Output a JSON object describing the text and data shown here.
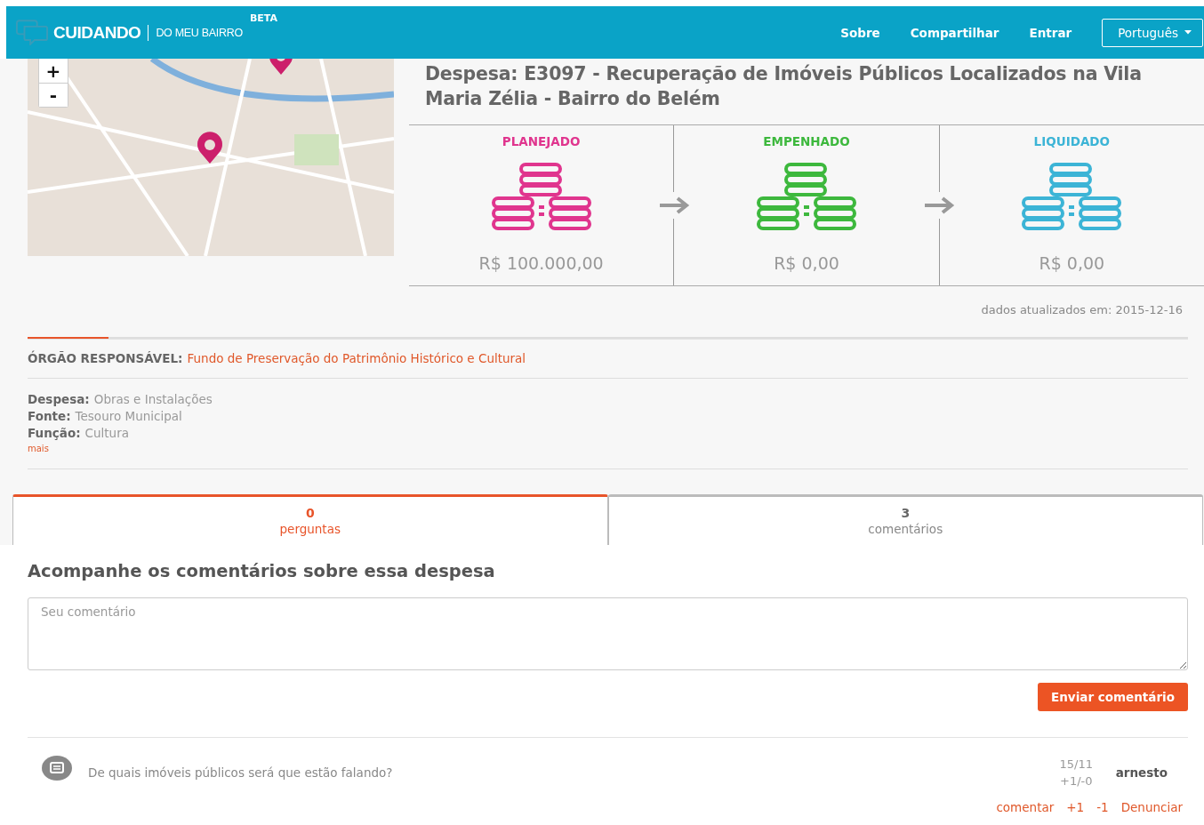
{
  "header": {
    "logo_main": "CUIDANDO",
    "logo_sub": "DO MEU BAIRRO",
    "badge": "BETA",
    "nav": [
      "Sobre",
      "Compartilhar",
      "Entrar"
    ],
    "language": "Português"
  },
  "map": {
    "zoom_in": "+",
    "zoom_out": "-"
  },
  "title": "Despesa: E3097 - Recuperação de Imóveis Públicos Localizados na Vila Maria Zélia - Bairro do Belém",
  "stages": [
    {
      "label": "PLANEJADO",
      "value": "R$ 100.000,00",
      "color": "#e0358e"
    },
    {
      "label": "EMPENHADO",
      "value": "R$ 0,00",
      "color": "#3db83d"
    },
    {
      "label": "LIQUIDADO",
      "value": "R$ 0,00",
      "color": "#3cb4d6"
    }
  ],
  "updated": "dados atualizados em: 2015-12-16",
  "agency": {
    "label": "ÓRGÃO RESPONSÁVEL:",
    "value": "Fundo de Preservação do Patrimônio Histórico e Cultural"
  },
  "details": [
    {
      "label": "Despesa:",
      "value": "Obras e Instalações"
    },
    {
      "label": "Fonte:",
      "value": "Tesouro Municipal"
    },
    {
      "label": "Função:",
      "value": "Cultura"
    }
  ],
  "more": "mais",
  "tabs": [
    {
      "count": "0",
      "label": "perguntas",
      "selected": true
    },
    {
      "count": "3",
      "label": "comentários",
      "selected": false
    }
  ],
  "section_heading": "Acompanhe os comentários sobre essa despesa",
  "comment_field": {
    "placeholder": "Seu comentário"
  },
  "submit": "Enviar comentário",
  "comments": [
    {
      "text": "De quais imóveis públicos será que estão falando?",
      "date": "15/11",
      "votes": "+1/-0",
      "author": "arnesto",
      "actions": [
        "comentar",
        "+1",
        "-1",
        "Denunciar"
      ]
    }
  ]
}
